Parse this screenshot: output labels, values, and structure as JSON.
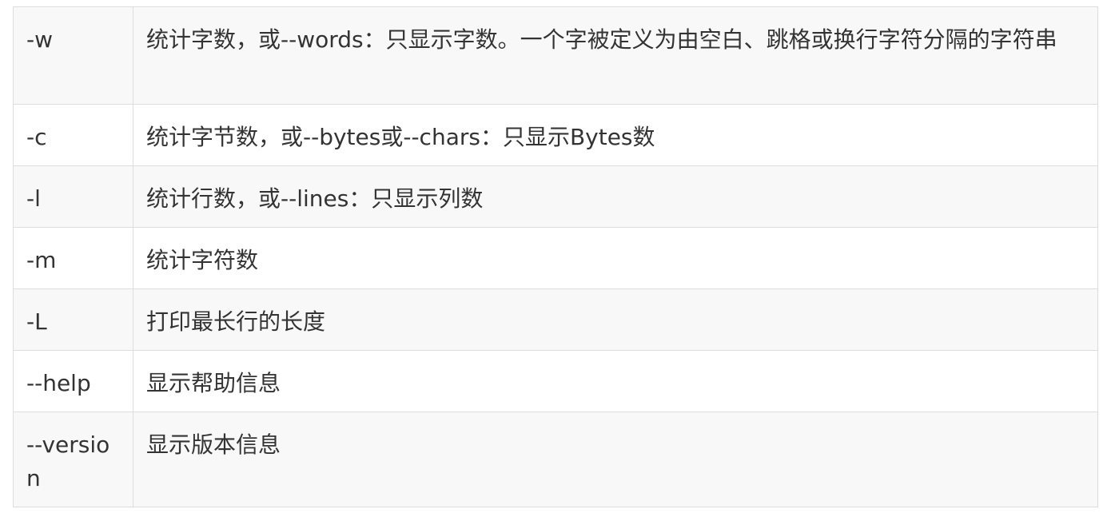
{
  "table": {
    "rows": [
      {
        "option": "-w",
        "description": "统计字数，或--words：只显示字数。一个字被定义为由空白、跳格或换行字符分隔的字符串"
      },
      {
        "option": "-c",
        "description": "统计字节数，或--bytes或--chars：只显示Bytes数"
      },
      {
        "option": "-l",
        "description": "统计行数，或--lines：只显示列数"
      },
      {
        "option": "-m",
        "description": "统计字符数"
      },
      {
        "option": "-L",
        "description": "打印最长行的长度"
      },
      {
        "option": "--help",
        "description": "显示帮助信息"
      },
      {
        "option": "--version",
        "description": "显示版本信息"
      }
    ]
  }
}
